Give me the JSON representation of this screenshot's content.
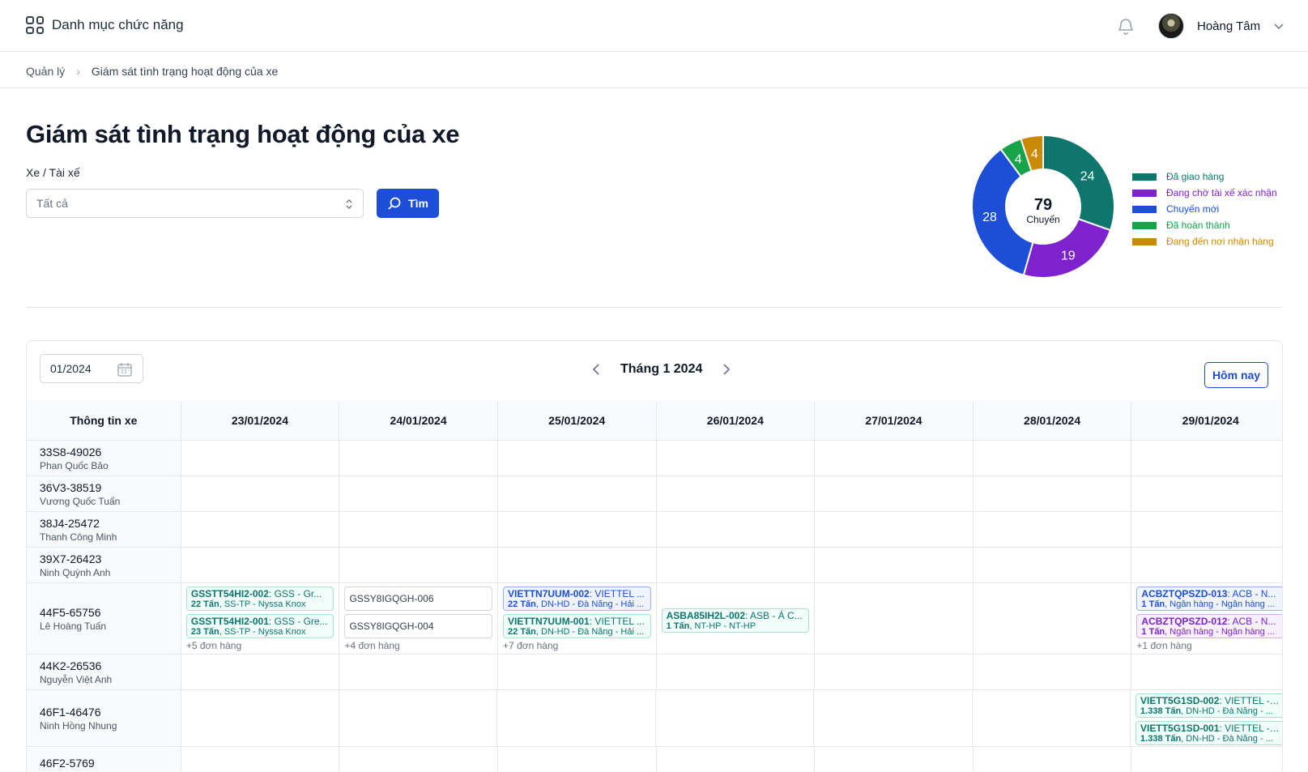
{
  "topbar": {
    "menu_label": "Danh mục chức năng",
    "user_name": "Hoàng Tâm",
    "icons": [
      "grid-icon",
      "bell-icon",
      "avatar",
      "chevron-down-icon"
    ]
  },
  "breadcrumb": {
    "items": [
      "Quản lý",
      "Giám sát tình trạng hoạt động của xe"
    ]
  },
  "page": {
    "title": "Giám sát tình trạng hoạt động của xe",
    "filter_label": "Xe / Tài xế",
    "filter_value": "Tất cả",
    "search_label": "Tìm"
  },
  "summary": {
    "total": "79",
    "total_unit": "Chuyến",
    "chart_data": {
      "type": "pie",
      "categories": [
        "Đã giao hàng",
        "Đang chờ tài xế xác nhận",
        "Chuyến mới",
        "Đã hoàn thành",
        "Đang đến nơi nhận hàng"
      ],
      "values": [
        24,
        19,
        28,
        4,
        4
      ],
      "colors": [
        "#0f766e",
        "#7e22ce",
        "#1d4ed8",
        "#16a34a",
        "#ca8a04"
      ]
    }
  },
  "calendar": {
    "month_value": "01/2024",
    "month_title": "Tháng 1 2024",
    "today_label": "Hôm nay",
    "first_col_header": "Thông tin xe",
    "dates": [
      "23/01/2024",
      "24/01/2024",
      "25/01/2024",
      "26/01/2024",
      "27/01/2024",
      "28/01/2024",
      "29/01/2024"
    ],
    "vehicles": [
      {
        "plate": "33S8-49026",
        "driver": "Phan Quốc Bảo",
        "days": []
      },
      {
        "plate": "36V3-38519",
        "driver": "Vương Quốc Tuấn",
        "days": []
      },
      {
        "plate": "38J4-25472",
        "driver": "Thanh Công Minh",
        "days": []
      },
      {
        "plate": "39X7-26423",
        "driver": "Ninh Quỳnh Anh",
        "days": []
      },
      {
        "plate": "44F5-65756",
        "driver": "Lê Hoàng Tuấn",
        "days": [
          {
            "day": 0,
            "trips": [
              {
                "code": "GSSTT54HI2-002",
                "desc": ": GSS - Gr...",
                "weight": "22 Tấn",
                "route": ", SS-TP - Nyssa Knox",
                "color": "green"
              },
              {
                "code": "GSSTT54HI2-001",
                "desc": ": GSS - Gre...",
                "weight": "23 Tấn",
                "route": ", SS-TP - Nyssa Knox",
                "color": "green"
              }
            ],
            "more": "+5 đơn hàng"
          },
          {
            "day": 1,
            "trips": [
              {
                "code": "GSSY8IGQGH-006",
                "desc": "",
                "weight": "",
                "route": "",
                "color": "gray"
              },
              {
                "code": "GSSY8IGQGH-004",
                "desc": "",
                "weight": "",
                "route": "",
                "color": "gray"
              }
            ],
            "more": "+4 đơn hàng"
          },
          {
            "day": 2,
            "trips": [
              {
                "code": "VIETTN7UUM-002",
                "desc": ": VIETTEL ...",
                "weight": "22 Tấn",
                "route": ", DN-HD - Đà Nẵng - Hải ...",
                "color": "blue"
              },
              {
                "code": "VIETTN7UUM-001",
                "desc": ": VIETTEL ...",
                "weight": "22 Tấn",
                "route": ", DN-HD - Đà Nẵng - Hải ...",
                "color": "green"
              }
            ],
            "more": "+7 đơn hàng"
          },
          {
            "day": 3,
            "trips": [
              {
                "code": "ASBA85IH2L-002",
                "desc": ": ASB - Á C...",
                "weight": "1 Tấn",
                "route": ", NT-HP - NT-HP",
                "color": "green"
              }
            ],
            "more": ""
          },
          {
            "day": 6,
            "trips": [
              {
                "code": "ACBZTQPSZD-013",
                "desc": ": ACB - N...",
                "weight": "1 Tấn",
                "route": ", Ngân hàng - Ngân hàng ...",
                "color": "blue"
              },
              {
                "code": "ACBZTQPSZD-012",
                "desc": ": ACB - N...",
                "weight": "1 Tấn",
                "route": ", Ngân hàng - Ngân hàng ...",
                "color": "purple"
              }
            ],
            "more": "+1 đơn hàng"
          }
        ]
      },
      {
        "plate": "44K2-26536",
        "driver": "Nguyễn Việt Anh",
        "days": []
      },
      {
        "plate": "46F1-46476",
        "driver": "Ninh Hồng Nhung",
        "days": [
          {
            "day": 6,
            "trips": [
              {
                "code": "VIETT5G1SD-002",
                "desc": ": VIETTEL - ...",
                "weight": "1.338 Tấn",
                "route": ", DN-HD - Đà Nẵng - ...",
                "color": "green"
              },
              {
                "code": "VIETT5G1SD-001",
                "desc": ": VIETTEL - ...",
                "weight": "1.338 Tấn",
                "route": ", DN-HD - Đà Nẵng - ...",
                "color": "green"
              }
            ],
            "more": ""
          }
        ]
      },
      {
        "plate": "46F2-5769",
        "driver": "",
        "days": []
      }
    ]
  }
}
